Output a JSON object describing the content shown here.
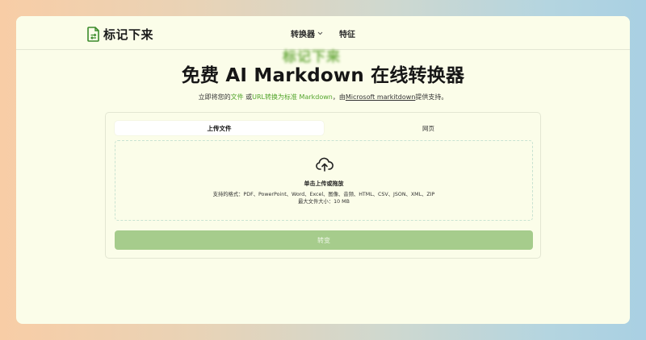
{
  "brand": {
    "name": "标记下来",
    "accent": "#52a42b"
  },
  "nav": {
    "converter_label": "转换器",
    "features_label": "特征"
  },
  "ghost_title": "标记下来",
  "hero": {
    "title": "免费 AI Markdown 在线转换器",
    "subtitle": {
      "p1": "立即将您的",
      "file": "文件",
      "p2": " 或",
      "url": "URL转换为标准 Markdown",
      "p3": "，由",
      "link": "Microsoft markitdown",
      "p4": "提供支持。"
    }
  },
  "tabs": [
    {
      "label": "上传文件",
      "active": true
    },
    {
      "label": "网页",
      "active": false
    }
  ],
  "dropzone": {
    "icon": "cloud-upload-icon",
    "prompt": "单击上传或拖放",
    "formats": "支持的格式：PDF、PowerPoint、Word、Excel、图像、音频、HTML、CSV、JSON、XML、ZIP",
    "max_size": "最大文件大小：10 MB"
  },
  "convert_button": {
    "label": "转变",
    "color": "#a6cc8c"
  }
}
